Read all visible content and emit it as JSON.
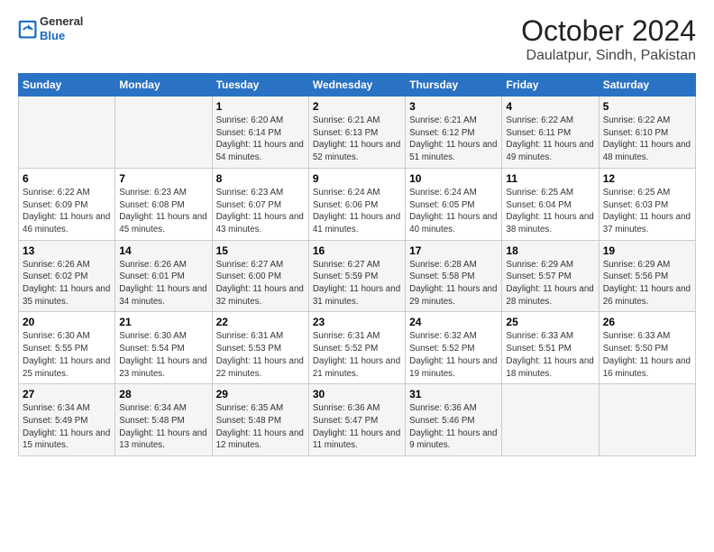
{
  "logo": {
    "general": "General",
    "blue": "Blue"
  },
  "title": "October 2024",
  "subtitle": "Daulatpur, Sindh, Pakistan",
  "headers": [
    "Sunday",
    "Monday",
    "Tuesday",
    "Wednesday",
    "Thursday",
    "Friday",
    "Saturday"
  ],
  "weeks": [
    [
      {
        "day": "",
        "info": ""
      },
      {
        "day": "",
        "info": ""
      },
      {
        "day": "1",
        "info": "Sunrise: 6:20 AM\nSunset: 6:14 PM\nDaylight: 11 hours and 54 minutes."
      },
      {
        "day": "2",
        "info": "Sunrise: 6:21 AM\nSunset: 6:13 PM\nDaylight: 11 hours and 52 minutes."
      },
      {
        "day": "3",
        "info": "Sunrise: 6:21 AM\nSunset: 6:12 PM\nDaylight: 11 hours and 51 minutes."
      },
      {
        "day": "4",
        "info": "Sunrise: 6:22 AM\nSunset: 6:11 PM\nDaylight: 11 hours and 49 minutes."
      },
      {
        "day": "5",
        "info": "Sunrise: 6:22 AM\nSunset: 6:10 PM\nDaylight: 11 hours and 48 minutes."
      }
    ],
    [
      {
        "day": "6",
        "info": "Sunrise: 6:22 AM\nSunset: 6:09 PM\nDaylight: 11 hours and 46 minutes."
      },
      {
        "day": "7",
        "info": "Sunrise: 6:23 AM\nSunset: 6:08 PM\nDaylight: 11 hours and 45 minutes."
      },
      {
        "day": "8",
        "info": "Sunrise: 6:23 AM\nSunset: 6:07 PM\nDaylight: 11 hours and 43 minutes."
      },
      {
        "day": "9",
        "info": "Sunrise: 6:24 AM\nSunset: 6:06 PM\nDaylight: 11 hours and 41 minutes."
      },
      {
        "day": "10",
        "info": "Sunrise: 6:24 AM\nSunset: 6:05 PM\nDaylight: 11 hours and 40 minutes."
      },
      {
        "day": "11",
        "info": "Sunrise: 6:25 AM\nSunset: 6:04 PM\nDaylight: 11 hours and 38 minutes."
      },
      {
        "day": "12",
        "info": "Sunrise: 6:25 AM\nSunset: 6:03 PM\nDaylight: 11 hours and 37 minutes."
      }
    ],
    [
      {
        "day": "13",
        "info": "Sunrise: 6:26 AM\nSunset: 6:02 PM\nDaylight: 11 hours and 35 minutes."
      },
      {
        "day": "14",
        "info": "Sunrise: 6:26 AM\nSunset: 6:01 PM\nDaylight: 11 hours and 34 minutes."
      },
      {
        "day": "15",
        "info": "Sunrise: 6:27 AM\nSunset: 6:00 PM\nDaylight: 11 hours and 32 minutes."
      },
      {
        "day": "16",
        "info": "Sunrise: 6:27 AM\nSunset: 5:59 PM\nDaylight: 11 hours and 31 minutes."
      },
      {
        "day": "17",
        "info": "Sunrise: 6:28 AM\nSunset: 5:58 PM\nDaylight: 11 hours and 29 minutes."
      },
      {
        "day": "18",
        "info": "Sunrise: 6:29 AM\nSunset: 5:57 PM\nDaylight: 11 hours and 28 minutes."
      },
      {
        "day": "19",
        "info": "Sunrise: 6:29 AM\nSunset: 5:56 PM\nDaylight: 11 hours and 26 minutes."
      }
    ],
    [
      {
        "day": "20",
        "info": "Sunrise: 6:30 AM\nSunset: 5:55 PM\nDaylight: 11 hours and 25 minutes."
      },
      {
        "day": "21",
        "info": "Sunrise: 6:30 AM\nSunset: 5:54 PM\nDaylight: 11 hours and 23 minutes."
      },
      {
        "day": "22",
        "info": "Sunrise: 6:31 AM\nSunset: 5:53 PM\nDaylight: 11 hours and 22 minutes."
      },
      {
        "day": "23",
        "info": "Sunrise: 6:31 AM\nSunset: 5:52 PM\nDaylight: 11 hours and 21 minutes."
      },
      {
        "day": "24",
        "info": "Sunrise: 6:32 AM\nSunset: 5:52 PM\nDaylight: 11 hours and 19 minutes."
      },
      {
        "day": "25",
        "info": "Sunrise: 6:33 AM\nSunset: 5:51 PM\nDaylight: 11 hours and 18 minutes."
      },
      {
        "day": "26",
        "info": "Sunrise: 6:33 AM\nSunset: 5:50 PM\nDaylight: 11 hours and 16 minutes."
      }
    ],
    [
      {
        "day": "27",
        "info": "Sunrise: 6:34 AM\nSunset: 5:49 PM\nDaylight: 11 hours and 15 minutes."
      },
      {
        "day": "28",
        "info": "Sunrise: 6:34 AM\nSunset: 5:48 PM\nDaylight: 11 hours and 13 minutes."
      },
      {
        "day": "29",
        "info": "Sunrise: 6:35 AM\nSunset: 5:48 PM\nDaylight: 11 hours and 12 minutes."
      },
      {
        "day": "30",
        "info": "Sunrise: 6:36 AM\nSunset: 5:47 PM\nDaylight: 11 hours and 11 minutes."
      },
      {
        "day": "31",
        "info": "Sunrise: 6:36 AM\nSunset: 5:46 PM\nDaylight: 11 hours and 9 minutes."
      },
      {
        "day": "",
        "info": ""
      },
      {
        "day": "",
        "info": ""
      }
    ]
  ]
}
